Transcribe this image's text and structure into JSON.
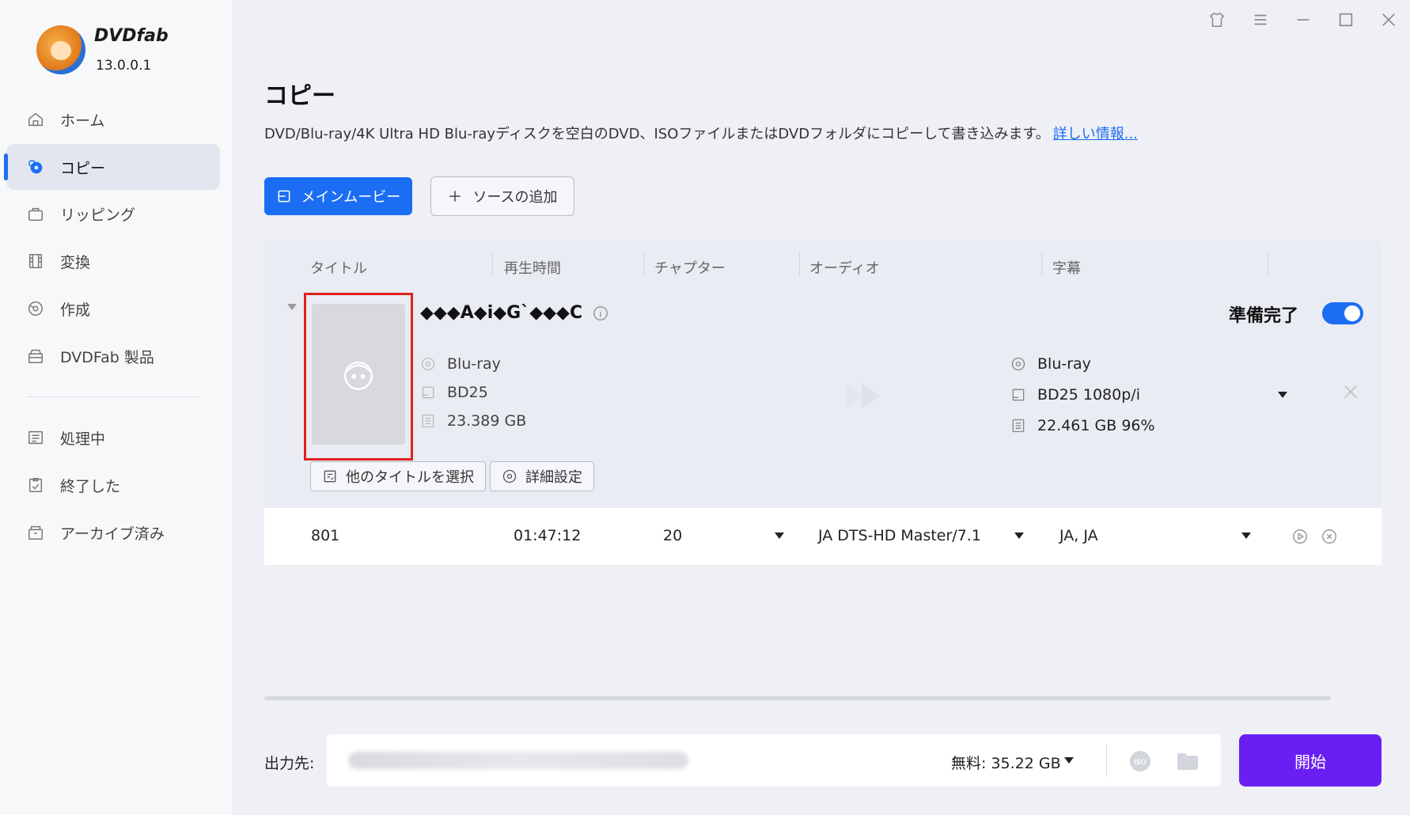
{
  "app": {
    "brand": "DVDfab",
    "version": "13.0.0.1"
  },
  "sidebar": {
    "items": [
      {
        "label": "ホーム",
        "icon": "home-icon"
      },
      {
        "label": "コピー",
        "icon": "copy-disc-icon",
        "active": true
      },
      {
        "label": "リッピング",
        "icon": "ripper-icon"
      },
      {
        "label": "変換",
        "icon": "film-icon"
      },
      {
        "label": "作成",
        "icon": "creator-icon"
      },
      {
        "label": "DVDFab 製品",
        "icon": "box-icon"
      }
    ],
    "queue_items": [
      {
        "label": "処理中",
        "icon": "processing-icon"
      },
      {
        "label": "終了した",
        "icon": "finished-icon"
      },
      {
        "label": "アーカイブ済み",
        "icon": "archive-icon"
      }
    ]
  },
  "window_controls": [
    "shirt-icon",
    "menu-icon",
    "minimize-icon",
    "maximize-icon",
    "close-icon"
  ],
  "main": {
    "title": "コピー",
    "description": "DVD/Blu-ray/4K Ultra HD Blu-rayディスクを空白のDVD、ISOファイルまたはDVDフォルダにコピーして書き込みます。",
    "more_info_link": "詳しい情報...",
    "mode_button": "メインムービー",
    "add_source_button": "ソースの追加",
    "columns": [
      "タイトル",
      "再生時間",
      "チャプター",
      "オーディオ",
      "字幕"
    ],
    "item": {
      "title": "◆◆◆A◆i◆G`◆◆◆C",
      "ready_label": "準備完了",
      "ready_toggle": true,
      "source": {
        "disc_type": "Blu-ray",
        "format": "BD25",
        "size": "23.389 GB"
      },
      "output": {
        "disc_type": "Blu-ray",
        "format": "BD25 1080p/i",
        "size": "22.461 GB 96%"
      },
      "select_titles_button": "他のタイトルを選択",
      "advanced_settings_button": "詳細設定"
    },
    "row": {
      "title": "801",
      "duration": "01:47:12",
      "chapters": "20",
      "audio": "JA  DTS-HD Master/7.1",
      "subtitles": "JA, JA"
    }
  },
  "footer": {
    "output_label": "出力先:",
    "free_space": "無料:  35.22 GB",
    "iso_label": "ISO",
    "start_button": "開始"
  },
  "colors": {
    "accent": "#1b6ef3",
    "start": "#6a1ff2",
    "highlight_box": "#e02020"
  }
}
